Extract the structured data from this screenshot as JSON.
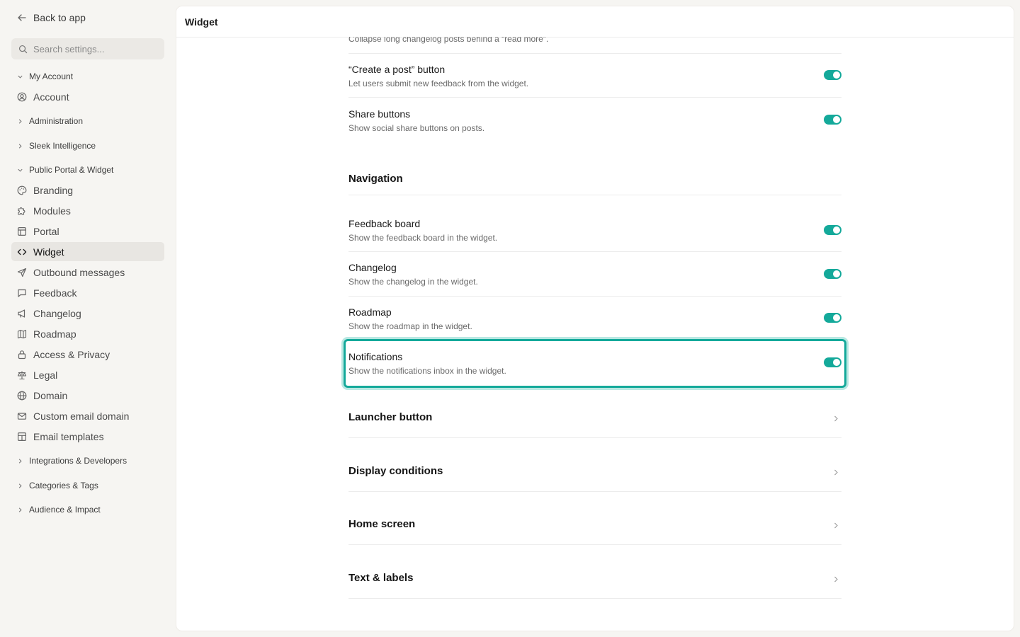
{
  "sidebar": {
    "back_label": "Back to app",
    "search_placeholder": "Search settings...",
    "groups": {
      "my_account": "My Account",
      "administration": "Administration",
      "sleek_intelligence": "Sleek Intelligence",
      "public_portal": "Public Portal & Widget",
      "integrations": "Integrations & Developers",
      "categories": "Categories & Tags",
      "audience": "Audience & Impact"
    },
    "items": {
      "account": "Account",
      "branding": "Branding",
      "modules": "Modules",
      "portal": "Portal",
      "widget": "Widget",
      "outbound": "Outbound messages",
      "feedback": "Feedback",
      "changelog": "Changelog",
      "roadmap": "Roadmap",
      "access": "Access & Privacy",
      "legal": "Legal",
      "domain": "Domain",
      "custom_email": "Custom email domain",
      "email_templates": "Email templates"
    },
    "active_item": "Widget"
  },
  "main": {
    "title": "Widget",
    "truncated_desc": "Collapse long changelog posts behind a “read more”.",
    "settings": {
      "create_post": {
        "title": "“Create a post” button",
        "desc": "Let users submit new feedback from the widget.",
        "enabled": true
      },
      "share_buttons": {
        "title": "Share buttons",
        "desc": "Show social share buttons on posts.",
        "enabled": true
      }
    },
    "navigation": {
      "heading": "Navigation",
      "feedback_board": {
        "title": "Feedback board",
        "desc": "Show the feedback board in the widget.",
        "enabled": true
      },
      "changelog": {
        "title": "Changelog",
        "desc": "Show the changelog in the widget.",
        "enabled": true
      },
      "roadmap": {
        "title": "Roadmap",
        "desc": "Show the roadmap in the widget.",
        "enabled": true
      },
      "notifications": {
        "title": "Notifications",
        "desc": "Show the notifications inbox in the widget.",
        "enabled": true
      }
    },
    "sections": {
      "launcher": "Launcher button",
      "display_conditions": "Display conditions",
      "home_screen": "Home screen",
      "text_labels": "Text & labels"
    }
  },
  "colors": {
    "accent": "#14a99a",
    "highlight_glow": "#b8e8e2",
    "sidebar_bg": "#f6f5f2"
  }
}
